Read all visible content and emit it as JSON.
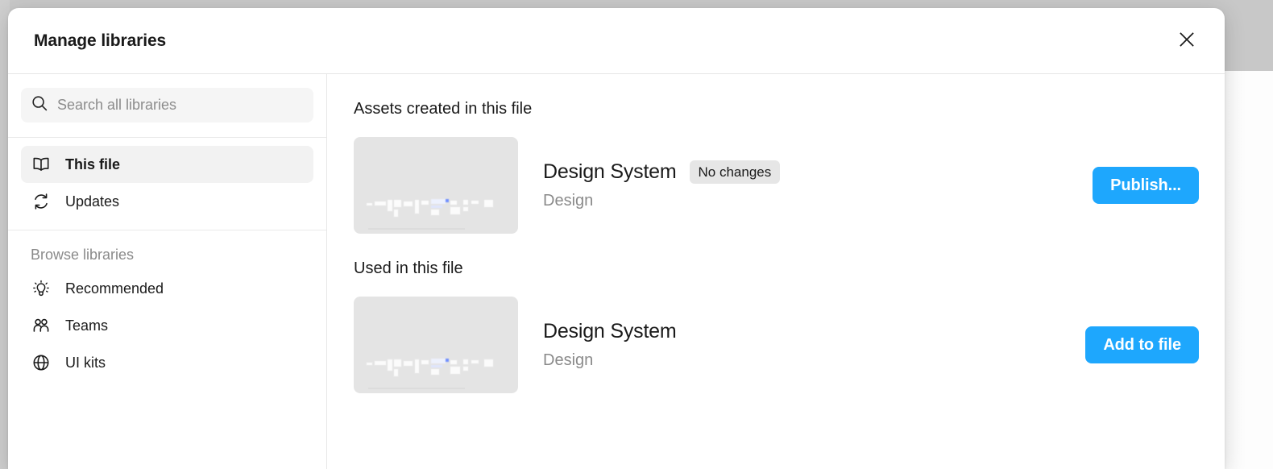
{
  "modal": {
    "title": "Manage libraries",
    "close_icon": "close-icon"
  },
  "sidebar": {
    "search": {
      "placeholder": "Search all libraries",
      "value": "",
      "icon": "search-icon"
    },
    "primary_items": [
      {
        "label": "This file",
        "icon": "book-icon",
        "active": true
      },
      {
        "label": "Updates",
        "icon": "refresh-icon",
        "active": false
      }
    ],
    "browse_section_label": "Browse libraries",
    "browse_items": [
      {
        "label": "Recommended",
        "icon": "lightbulb-icon",
        "active": false
      },
      {
        "label": "Teams",
        "icon": "people-icon",
        "active": false
      },
      {
        "label": "UI kits",
        "icon": "globe-icon",
        "active": false
      }
    ]
  },
  "main": {
    "sections": [
      {
        "heading": "Assets created in this file",
        "asset": {
          "title": "Design System",
          "badge": "No changes",
          "subtitle": "Design",
          "action_label": "Publish..."
        }
      },
      {
        "heading": "Used in this file",
        "asset": {
          "title": "Design System",
          "badge": "",
          "subtitle": "Design",
          "action_label": "Add to file"
        }
      }
    ]
  },
  "colors": {
    "accent": "#1ea7fd",
    "badge_bg": "#e6e6e6",
    "active_nav_bg": "#f2f2f2",
    "search_bg": "#f5f5f5",
    "thumb_bg": "#e4e4e4"
  }
}
